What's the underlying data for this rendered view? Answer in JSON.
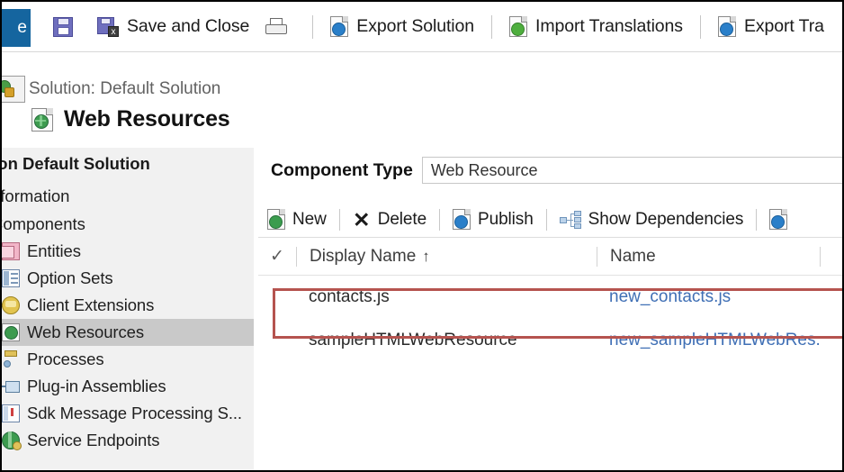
{
  "ribbon": {
    "tab_label": "e",
    "items": [
      {
        "icon": "save-icon",
        "label": ""
      },
      {
        "icon": "save-and-close-icon",
        "label": "Save and Close"
      },
      {
        "icon": "print-icon",
        "label": ""
      },
      {
        "icon": "export-solution-icon",
        "label": "Export Solution"
      },
      {
        "icon": "import-translations-icon",
        "label": "Import Translations"
      },
      {
        "icon": "export-translations-icon",
        "label": "Export Tra"
      }
    ]
  },
  "header": {
    "solution_line": "Solution: Default Solution",
    "page_title": "Web Resources",
    "subheader": "tion Default Solution"
  },
  "sidebar": {
    "sections": [
      {
        "label": "nformation"
      },
      {
        "label": "Components"
      }
    ],
    "items": [
      {
        "label": "Entities",
        "icon": "entities-icon",
        "selected": false,
        "expander": false
      },
      {
        "label": "Option Sets",
        "icon": "option-sets-icon",
        "selected": false,
        "expander": false
      },
      {
        "label": "Client Extensions",
        "icon": "client-extensions-icon",
        "selected": false,
        "expander": true
      },
      {
        "label": "Web Resources",
        "icon": "web-resources-icon",
        "selected": true,
        "expander": false
      },
      {
        "label": "Processes",
        "icon": "processes-icon",
        "selected": false,
        "expander": false
      },
      {
        "label": "Plug-in Assemblies",
        "icon": "plugin-assemblies-icon",
        "selected": false,
        "expander": false
      },
      {
        "label": "Sdk Message Processing S...",
        "icon": "sdk-message-icon",
        "selected": false,
        "expander": false
      },
      {
        "label": "Service Endpoints",
        "icon": "service-endpoints-icon",
        "selected": false,
        "expander": false
      }
    ]
  },
  "main": {
    "component_type_label": "Component Type",
    "component_type_value": "Web Resource",
    "commands": [
      {
        "label": "New",
        "icon": "new-icon"
      },
      {
        "label": "Delete",
        "icon": "delete-icon"
      },
      {
        "label": "Publish",
        "icon": "publish-icon"
      },
      {
        "label": "Show Dependencies",
        "icon": "show-dependencies-icon"
      }
    ],
    "grid": {
      "columns": [
        {
          "label": "Display Name",
          "sort": "↑"
        },
        {
          "label": "Name",
          "sort": ""
        }
      ],
      "rows": [
        {
          "display_name": "contacts.js",
          "name": "new_contacts.js",
          "highlighted": false
        },
        {
          "display_name": "sampleHTMLWebResource",
          "name": "new_sampleHTMLWebRes...",
          "highlighted": true
        }
      ]
    }
  },
  "colors": {
    "ribbon_tab": "#15659f",
    "highlight_box": "#b5534f",
    "link": "#3f6fb5",
    "selected_row": "#c9c9c9",
    "sidebar_bg": "#f1f1f1"
  }
}
